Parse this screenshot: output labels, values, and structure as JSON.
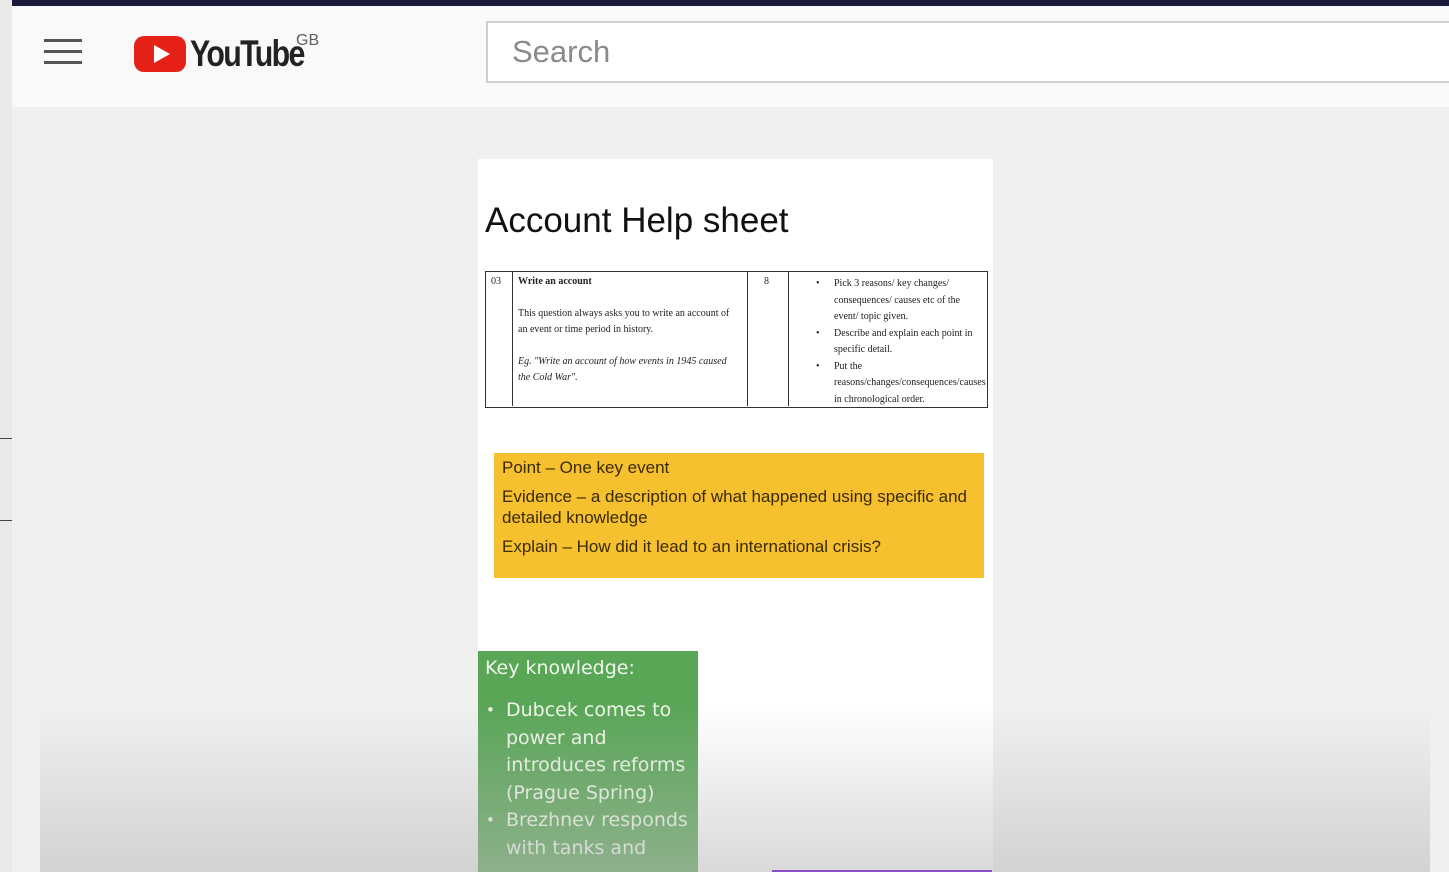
{
  "masthead": {
    "logo_text": "YouTube",
    "region": "GB",
    "search_placeholder": "Search"
  },
  "slide": {
    "title": "Account Help sheet",
    "table": {
      "num": "03",
      "heading": "Write an account",
      "desc": "This question always asks you to write an account of an event or time period in history.",
      "example": "Eg. \"Write an account of how events in 1945 caused the Cold War\".",
      "marks": "8",
      "bullets": [
        "Pick 3 reasons/ key changes/ consequences/ causes etc of the event/ topic given.",
        "Describe and explain each point in specific detail.",
        "Put the reasons/changes/consequences/causes in chronological order."
      ]
    },
    "pee": {
      "point": "Point – One key event",
      "evidence": "Evidence – a description of what happened using specific and detailed knowledge",
      "explain": "Explain – How did it lead to an international crisis?"
    },
    "key_knowledge": {
      "heading": "Key knowledge:",
      "items": [
        "Dubcek comes to power and introduces reforms (Prague Spring)",
        "Brezhnev responds with tanks and"
      ]
    }
  },
  "colors": {
    "youtube_red": "#ff0000",
    "slide_yellow": "#f6c02e",
    "slide_green": "#5aa657"
  },
  "icons": {
    "menu": "hamburger-menu-icon",
    "logo": "youtube-play-icon"
  }
}
